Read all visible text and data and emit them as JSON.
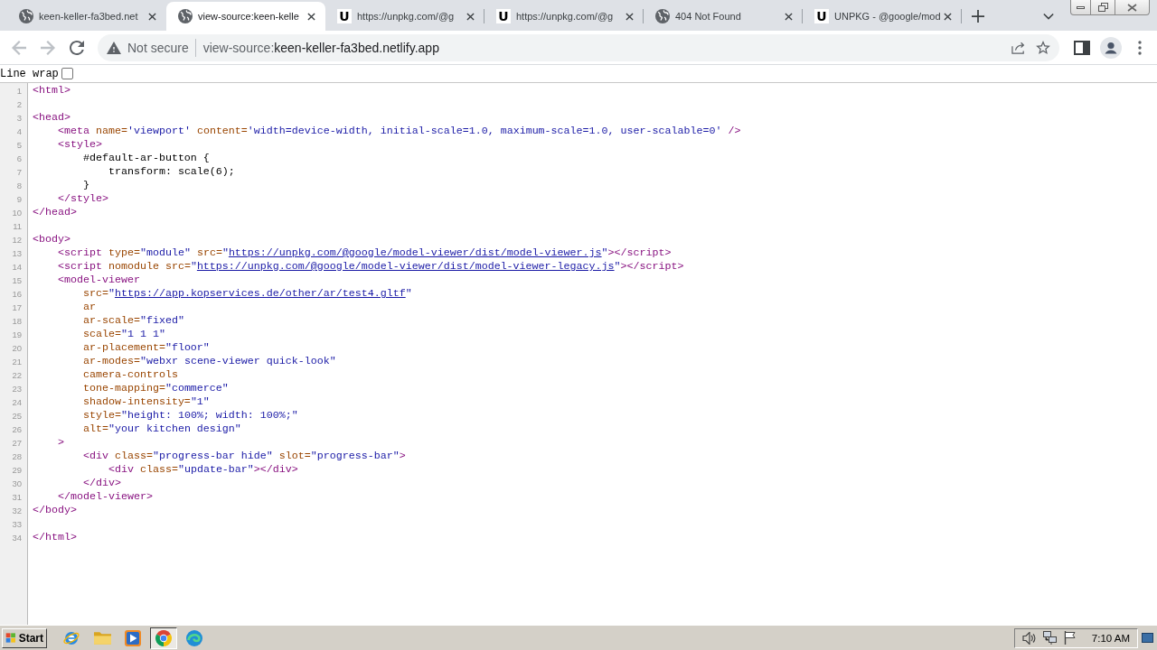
{
  "tabs": [
    {
      "kind": "globe",
      "title": "keen-keller-fa3bed.net",
      "selected": false
    },
    {
      "kind": "globe",
      "title": "view-source:keen-kelle",
      "selected": true
    },
    {
      "kind": "letter",
      "favicon": "U",
      "title": "https://unpkg.com/@g",
      "selected": false
    },
    {
      "kind": "letter",
      "favicon": "U",
      "title": "https://unpkg.com/@g",
      "selected": false
    },
    {
      "kind": "globe",
      "title": "404 Not Found",
      "selected": false
    },
    {
      "kind": "letter",
      "favicon": "U",
      "title": "UNPKG - @google/mod",
      "selected": false
    }
  ],
  "toolbar": {
    "back": {
      "disabled": true
    },
    "forward": {
      "disabled": true
    },
    "address_bar": {
      "security": "Not secure",
      "scheme": "view-source:",
      "host": "keen-keller-fa3bed.netlify.app"
    }
  },
  "line_wrap": {
    "label": "Line wrap",
    "checked": false
  },
  "source_lines": [
    {
      "number": "1",
      "tokens": [
        {
          "kind": "tag",
          "text": "<html>"
        }
      ]
    },
    {
      "number": "2"
    },
    {
      "number": "3",
      "tokens": [
        {
          "kind": "tag",
          "text": "<head>"
        }
      ],
      "children": [
        {
          "number": "4",
          "tokens": [
            {
              "kind": "tag",
              "text": "<meta "
            },
            {
              "kind": "attr",
              "text": "name="
            },
            {
              "kind": "value",
              "text": "'viewport' "
            },
            {
              "kind": "attr",
              "text": "content="
            },
            {
              "kind": "value",
              "text": "'width=device-width, initial-scale=1.0, maximum-scale=1.0, user-scalable=0' "
            },
            {
              "kind": "tag",
              "text": "/>"
            }
          ]
        },
        {
          "number": "5",
          "tokens": [
            {
              "kind": "tag",
              "text": "<style>"
            }
          ],
          "children": [
            {
              "number": "6",
              "tokens": [
                {
                  "kind": "text",
                  "text": "#default-ar-button {"
                }
              ],
              "children": [
                {
                  "number": "7",
                  "tokens": [
                    {
                      "kind": "text",
                      "text": "transform: scale(6);"
                    }
                  ]
                }
              ]
            },
            {
              "number": "8",
              "tokens": [
                {
                  "kind": "text",
                  "text": "}"
                }
              ]
            }
          ]
        },
        {
          "number": "9",
          "tokens": [
            {
              "kind": "tag",
              "text": "</style>"
            }
          ]
        }
      ]
    },
    {
      "number": "10",
      "tokens": [
        {
          "kind": "tag",
          "text": "</head>"
        }
      ]
    },
    {
      "number": "11"
    },
    {
      "number": "12",
      "tokens": [
        {
          "kind": "tag",
          "text": "<body>"
        }
      ],
      "children": [
        {
          "number": "13",
          "tokens": [
            {
              "kind": "tag",
              "text": "<script "
            },
            {
              "kind": "attr",
              "text": "type="
            },
            {
              "kind": "value",
              "text": "\"module\" "
            },
            {
              "kind": "attr",
              "text": "src="
            },
            {
              "kind": "value",
              "text": "\""
            },
            {
              "kind": "link",
              "text": "https://unpkg.com/@google/model-viewer/dist/model-viewer.js"
            },
            {
              "kind": "value",
              "text": "\""
            },
            {
              "kind": "tag",
              "text": "></script>"
            }
          ]
        },
        {
          "number": "14",
          "tokens": [
            {
              "kind": "tag",
              "text": "<script "
            },
            {
              "kind": "attr",
              "text": "nomodule src="
            },
            {
              "kind": "value",
              "text": "\""
            },
            {
              "kind": "link",
              "text": "https://unpkg.com/@google/model-viewer/dist/model-viewer-legacy.js"
            },
            {
              "kind": "value",
              "text": "\""
            },
            {
              "kind": "tag",
              "text": "></script>"
            }
          ]
        },
        {
          "number": "15",
          "tokens": [
            {
              "kind": "tag",
              "text": "<model-viewer"
            }
          ],
          "children": [
            {
              "number": "16",
              "tokens": [
                {
                  "kind": "attr",
                  "text": "src="
                },
                {
                  "kind": "value",
                  "text": "\""
                },
                {
                  "kind": "link",
                  "text": "https://app.kopservices.de/other/ar/test4.gltf"
                },
                {
                  "kind": "value",
                  "text": "\""
                }
              ]
            },
            {
              "number": "17",
              "tokens": [
                {
                  "kind": "attr",
                  "text": "ar"
                }
              ]
            },
            {
              "number": "18",
              "tokens": [
                {
                  "kind": "attr",
                  "text": "ar-scale="
                },
                {
                  "kind": "value",
                  "text": "\"fixed\""
                }
              ]
            },
            {
              "number": "19",
              "tokens": [
                {
                  "kind": "attr",
                  "text": "scale="
                },
                {
                  "kind": "value",
                  "text": "\"1 1 1\""
                }
              ]
            },
            {
              "number": "20",
              "tokens": [
                {
                  "kind": "attr",
                  "text": "ar-placement="
                },
                {
                  "kind": "value",
                  "text": "\"floor\""
                }
              ]
            },
            {
              "number": "21",
              "tokens": [
                {
                  "kind": "attr",
                  "text": "ar-modes="
                },
                {
                  "kind": "value",
                  "text": "\"webxr scene-viewer quick-look\""
                }
              ]
            },
            {
              "number": "22",
              "tokens": [
                {
                  "kind": "attr",
                  "text": "camera-controls"
                }
              ]
            },
            {
              "number": "23",
              "tokens": [
                {
                  "kind": "attr",
                  "text": "tone-mapping="
                },
                {
                  "kind": "value",
                  "text": "\"commerce\""
                }
              ]
            },
            {
              "number": "24",
              "tokens": [
                {
                  "kind": "attr",
                  "text": "shadow-intensity="
                },
                {
                  "kind": "value",
                  "text": "\"1\""
                }
              ]
            },
            {
              "number": "25",
              "tokens": [
                {
                  "kind": "attr",
                  "text": "style="
                },
                {
                  "kind": "value",
                  "text": "\"height: 100%; width: 100%;\""
                }
              ]
            },
            {
              "number": "26",
              "tokens": [
                {
                  "kind": "attr",
                  "text": "alt="
                },
                {
                  "kind": "value",
                  "text": "\"your kitchen design\""
                }
              ]
            }
          ]
        },
        {
          "number": "27",
          "tokens": [
            {
              "kind": "tag",
              "text": ">"
            }
          ],
          "children": [
            {
              "number": "28",
              "tokens": [
                {
                  "kind": "tag",
                  "text": "<div "
                },
                {
                  "kind": "attr",
                  "text": "class="
                },
                {
                  "kind": "value",
                  "text": "\"progress-bar hide\" "
                },
                {
                  "kind": "attr",
                  "text": "slot="
                },
                {
                  "kind": "value",
                  "text": "\"progress-bar\""
                },
                {
                  "kind": "tag",
                  "text": ">"
                }
              ],
              "children": [
                {
                  "number": "29",
                  "tokens": [
                    {
                      "kind": "tag",
                      "text": "<div "
                    },
                    {
                      "kind": "attr",
                      "text": "class="
                    },
                    {
                      "kind": "value",
                      "text": "\"update-bar\""
                    },
                    {
                      "kind": "tag",
                      "text": "></div>"
                    }
                  ]
                }
              ]
            },
            {
              "number": "30",
              "tokens": [
                {
                  "kind": "tag",
                  "text": "</div>"
                }
              ]
            }
          ]
        },
        {
          "number": "31",
          "tokens": [
            {
              "kind": "tag",
              "text": "</model-viewer>"
            }
          ]
        }
      ]
    },
    {
      "number": "32",
      "tokens": [
        {
          "kind": "tag",
          "text": "</body>"
        }
      ]
    },
    {
      "number": "33"
    },
    {
      "number": "34",
      "tokens": [
        {
          "kind": "tag",
          "text": "</html>"
        }
      ]
    }
  ],
  "taskbar": {
    "start": "Start",
    "apps": [
      {
        "kind": "e-ring",
        "selected": false
      },
      {
        "kind": "folder",
        "selected": false
      },
      {
        "kind": "play",
        "selected": false
      },
      {
        "kind": "tricolor",
        "selected": true
      },
      {
        "kind": "swirl",
        "selected": false
      }
    ],
    "clock": "7:10 AM"
  }
}
